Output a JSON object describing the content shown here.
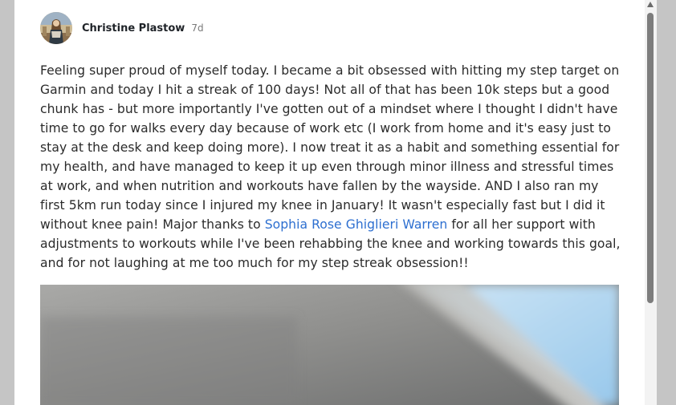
{
  "post": {
    "author": "Christine Plastow",
    "time": "7d",
    "body_before_mention": "Feeling super proud of myself today. I became a bit obsessed with hitting my step target on Garmin and today I hit a streak of 100 days! Not all of that has been 10k steps but a good chunk has - but more importantly I've gotten out of a mindset where I thought I didn't have time to go for walks every day because of work etc (I work from home and it's easy just to stay at the desk and keep doing more). I now treat it as a habit and something essential for my health, and have managed to keep it up even through minor illness and stressful times at work, and when nutrition and workouts have fallen by the wayside. AND I also ran my first 5km run today since I injured my knee in January! It wasn't especially fast but I did it without knee pain! Major thanks to ",
    "mention": "Sophia Rose Ghiglieri Warren",
    "body_after_mention": " for all her support with adjustments to workouts while I've been rehabbing the knee and working towards this goal, and for not laughing at me too much for my step streak obsession!!"
  },
  "colors": {
    "mention": "#2d6fd0",
    "backdrop": "#c5c5c5",
    "card": "#ffffff"
  },
  "icons": {
    "scroll_up": "triangle-up-icon"
  }
}
